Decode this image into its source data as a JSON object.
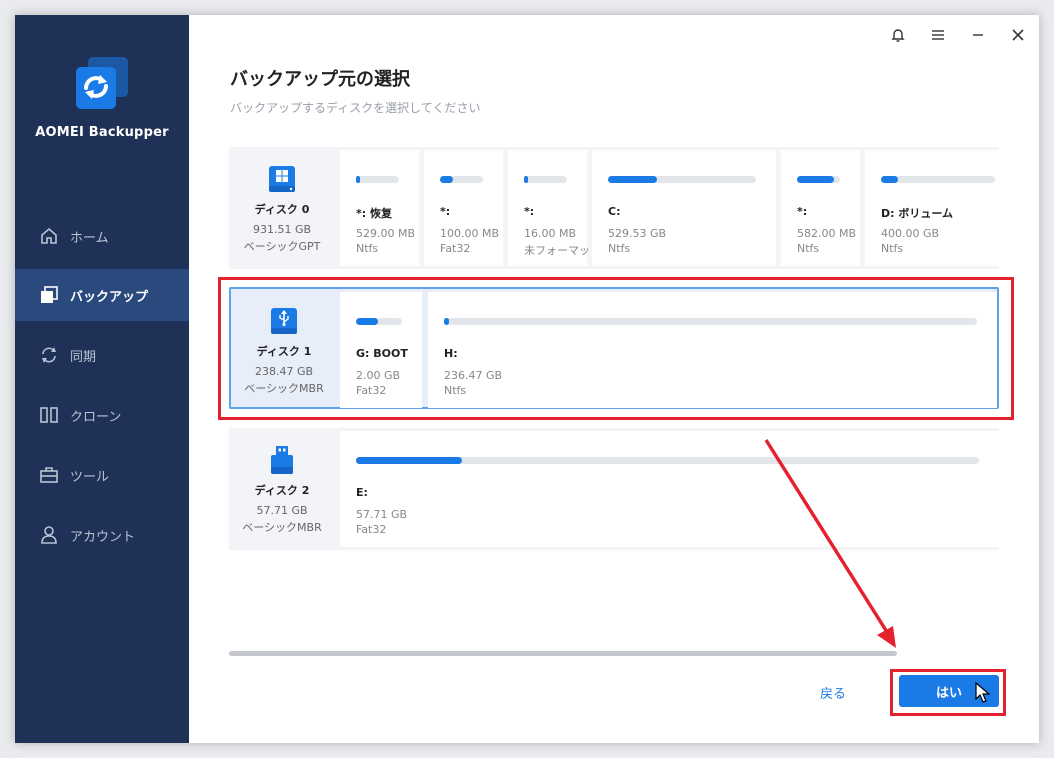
{
  "app": {
    "name": "AOMEI Backupper"
  },
  "sidebar": {
    "items": [
      {
        "label": "ホーム",
        "icon": "home-icon",
        "active": false
      },
      {
        "label": "バックアップ",
        "icon": "backup-icon",
        "active": true
      },
      {
        "label": "同期",
        "icon": "sync-icon",
        "active": false
      },
      {
        "label": "クローン",
        "icon": "clone-icon",
        "active": false
      },
      {
        "label": "ツール",
        "icon": "tools-icon",
        "active": false
      },
      {
        "label": "アカウント",
        "icon": "account-icon",
        "active": false
      }
    ]
  },
  "header": {
    "title": "バックアップ元の選択",
    "subtitle": "バックアップするディスクを選択してください"
  },
  "disks": [
    {
      "name": "ディスク 0",
      "size": "931.51 GB",
      "type": "ベーシックGPT",
      "icon": "hdd-windows-icon",
      "partitions": [
        {
          "label": "*: 恢复",
          "size": "529.00 MB",
          "fs": "Ntfs",
          "used": 0.05
        },
        {
          "label": "*:",
          "size": "100.00 MB",
          "fs": "Fat32",
          "used": 0.3
        },
        {
          "label": "*:",
          "size": "16.00 MB",
          "fs": "未フォーマット",
          "used": 0.02
        },
        {
          "label": "C:",
          "size": "529.53 GB",
          "fs": "Ntfs",
          "used": 0.33
        },
        {
          "label": "*:",
          "size": "582.00 MB",
          "fs": "Ntfs",
          "used": 0.85
        },
        {
          "label": "D: ボリューム",
          "size": "400.00 GB",
          "fs": "Ntfs",
          "used": 0.15
        }
      ]
    },
    {
      "name": "ディスク 1",
      "size": "238.47 GB",
      "type": "ベーシックMBR",
      "icon": "usb-drive-icon",
      "partitions": [
        {
          "label": "G: BOOT",
          "size": "2.00 GB",
          "fs": "Fat32",
          "used": 0.48
        },
        {
          "label": "H:",
          "size": "236.47 GB",
          "fs": "Ntfs",
          "used": 0.01
        }
      ]
    },
    {
      "name": "ディスク 2",
      "size": "57.71 GB",
      "type": "ベーシックMBR",
      "icon": "usb-stick-icon",
      "partitions": [
        {
          "label": "E:",
          "size": "57.71 GB",
          "fs": "Fat32",
          "used": 0.17
        }
      ]
    }
  ],
  "footer": {
    "back_label": "戻る",
    "yes_label": "はい"
  },
  "colors": {
    "sidebar_bg": "#1f3157",
    "sidebar_active": "#2a4a7e",
    "accent": "#1a7ae6",
    "annotation_red": "#e3222e"
  }
}
